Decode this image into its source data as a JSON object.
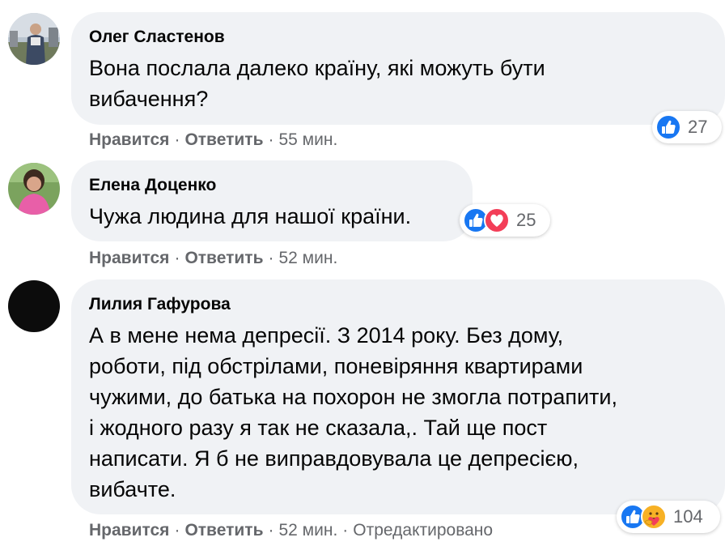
{
  "comments": [
    {
      "author": "Олег Сластенов",
      "text": "Вона послала далеко країну, які можуть бути вибачення?",
      "text_lines": [
        "Вона послала далеко країну, які можуть бути",
        "вибачення?"
      ],
      "actions": {
        "like": "Нравится",
        "reply": "Ответить",
        "time": "55 мин."
      },
      "reactions": {
        "icons": [
          "like-icon"
        ],
        "count": "27"
      }
    },
    {
      "author": "Елена Доценко",
      "text": "Чужа людина для нашої країни.",
      "text_lines": [
        "Чужа людина для нашої країни."
      ],
      "actions": {
        "like": "Нравится",
        "reply": "Ответить",
        "time": "52 мин."
      },
      "reactions": {
        "icons": [
          "like-icon",
          "love-icon"
        ],
        "count": "25"
      }
    },
    {
      "author": "Лилия Гафурова",
      "text": "А в мене нема депресії. З 2014 року. Без дому, роботи, під обстрілами, поневіряння квартирами чужими, до батька на похорон не змогла потрапити, і жодного разу я так не сказала,. Тай ще пост написати. Я б не виправдовувала це депресією, вибачте.",
      "text_lines": [
        "А в мене нема депресії. З 2014 року. Без дому,",
        "роботи, під обстрілами, поневіряння квартирами",
        "чужими, до батька на похорон не змогла потрапити,",
        "і жодного разу я так не сказала,. Тай ще пост",
        "написати. Я б не виправдовувала це депресією,",
        "вибачте."
      ],
      "actions": {
        "like": "Нравится",
        "reply": "Ответить",
        "time": "52 мин.",
        "edited": "Отредактировано"
      },
      "reactions": {
        "icons": [
          "like-icon",
          "care-icon"
        ],
        "count": "104"
      }
    }
  ],
  "separator": "·",
  "colors": {
    "bubble": "#f0f2f5",
    "meta": "#65676b",
    "text": "#050505",
    "like_blue": "#1877f2",
    "love_red": "#f33e58",
    "care_yellow": "#f7b125"
  }
}
